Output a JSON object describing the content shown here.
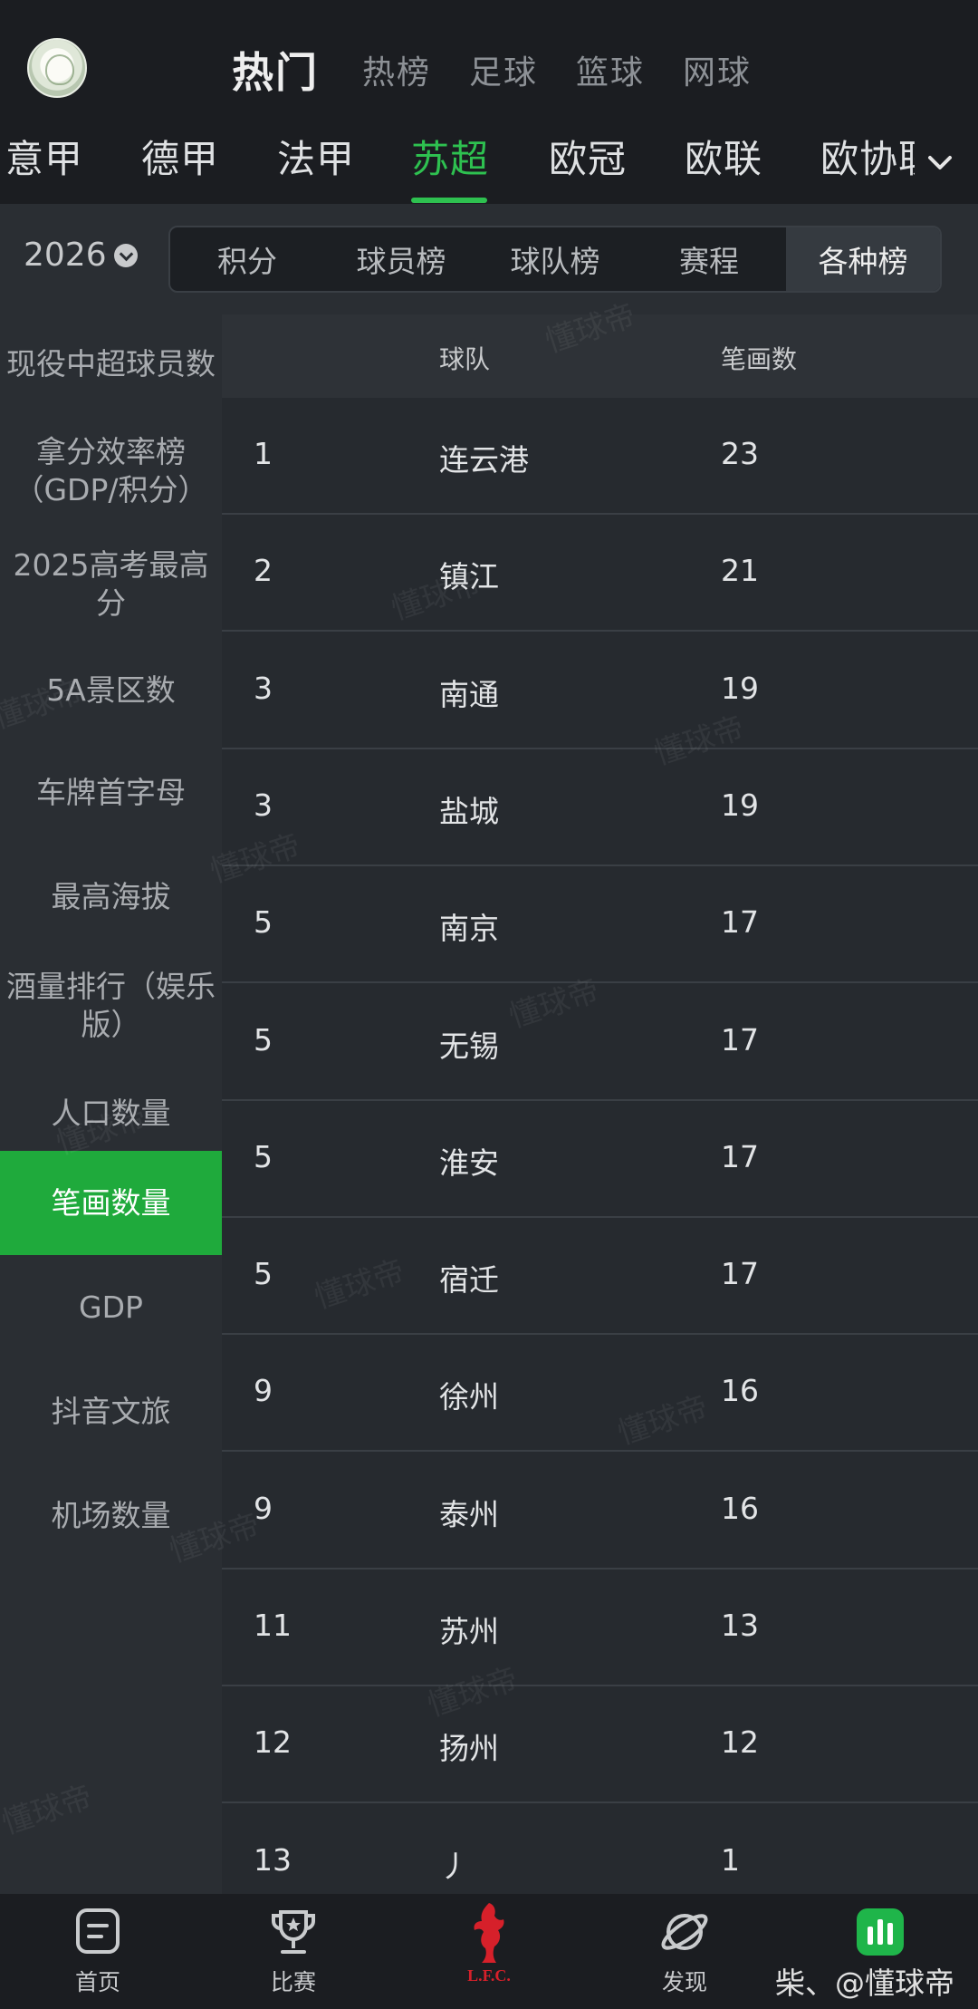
{
  "header": {
    "top_tabs": [
      "热门",
      "热榜",
      "足球",
      "篮球",
      "网球"
    ],
    "league_tabs": [
      "意甲",
      "德甲",
      "法甲",
      "苏超",
      "欧冠",
      "欧联",
      "欧协联"
    ]
  },
  "filter": {
    "season": "2026",
    "segments": [
      "积分",
      "球员榜",
      "球队榜",
      "赛程",
      "各种榜"
    ]
  },
  "sidebar": {
    "items": [
      "现役中超球员数",
      "拿分效率榜（GDP/积分）",
      "2025高考最高分",
      "5A景区数",
      "车牌首字母",
      "最高海拔",
      "酒量排行（娱乐版）",
      "人口数量",
      "笔画数量",
      "GDP",
      "抖音文旅",
      "机场数量"
    ]
  },
  "table": {
    "col_rank": "",
    "col_team": "球队",
    "col_value": "笔画数",
    "rows": [
      {
        "rank": "1",
        "team": "连云港",
        "value": "23"
      },
      {
        "rank": "2",
        "team": "镇江",
        "value": "21"
      },
      {
        "rank": "3",
        "team": "南通",
        "value": "19"
      },
      {
        "rank": "3",
        "team": "盐城",
        "value": "19"
      },
      {
        "rank": "5",
        "team": "南京",
        "value": "17"
      },
      {
        "rank": "5",
        "team": "无锡",
        "value": "17"
      },
      {
        "rank": "5",
        "team": "淮安",
        "value": "17"
      },
      {
        "rank": "5",
        "team": "宿迁",
        "value": "17"
      },
      {
        "rank": "9",
        "team": "徐州",
        "value": "16"
      },
      {
        "rank": "9",
        "team": "泰州",
        "value": "16"
      },
      {
        "rank": "11",
        "team": "苏州",
        "value": "13"
      },
      {
        "rank": "12",
        "team": "扬州",
        "value": "12"
      },
      {
        "rank": "13",
        "team": "丿",
        "value": "1"
      }
    ]
  },
  "watermark": "懂球帝",
  "bottom_nav": {
    "items": [
      {
        "label": "首页",
        "icon": "home-icon"
      },
      {
        "label": "比赛",
        "icon": "trophy-icon"
      },
      {
        "label": "",
        "icon": "lfc-logo-icon"
      },
      {
        "label": "发现",
        "icon": "planet-icon"
      },
      {
        "label": "",
        "icon": "stats-icon"
      }
    ],
    "credit": "柴、@懂球帝"
  },
  "colors": {
    "accent": "#2ec150",
    "active_sidebar": "#1faa3c",
    "background": "#1f2226"
  }
}
